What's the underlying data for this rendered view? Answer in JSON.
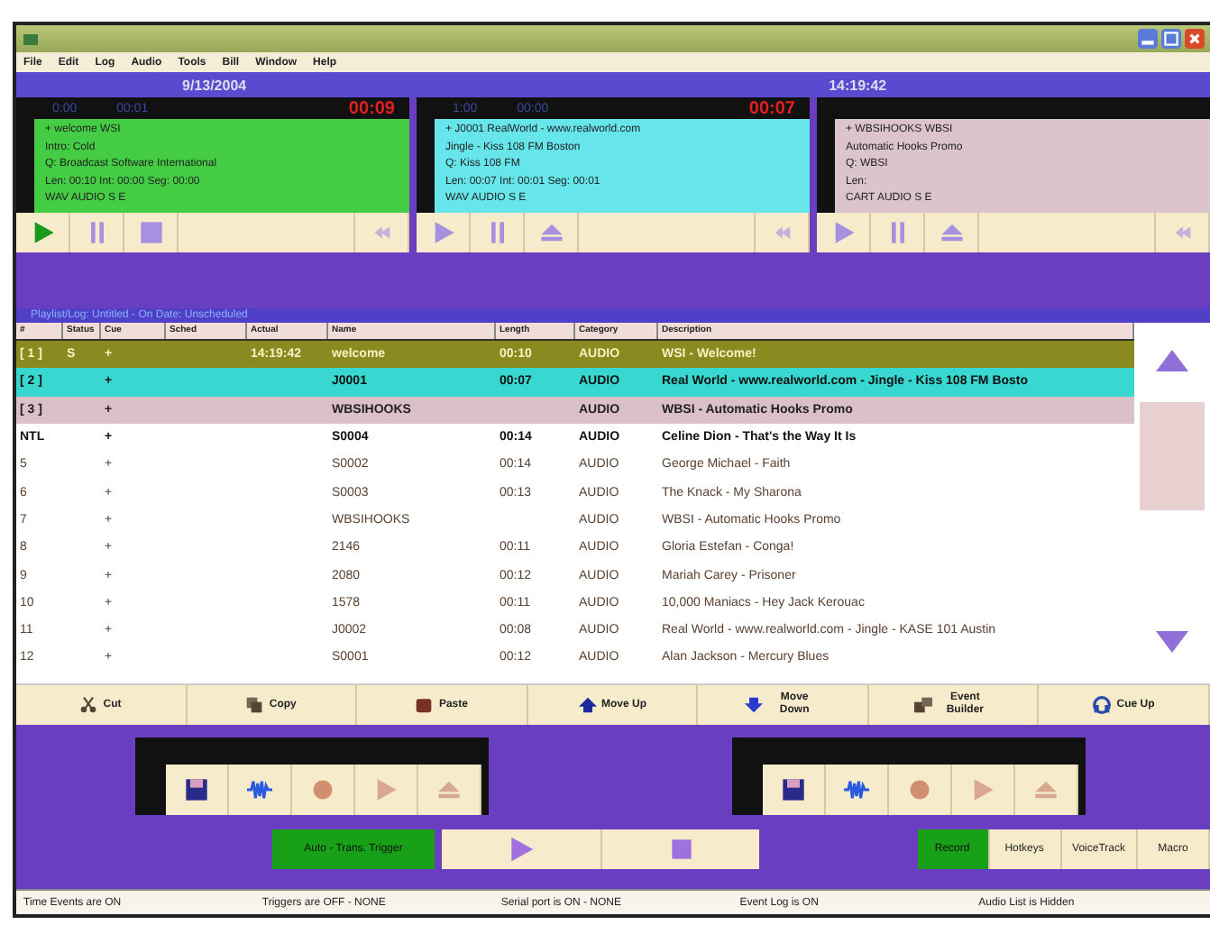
{
  "menu": [
    "File",
    "Edit",
    "Log",
    "Audio",
    "Tools",
    "Bill",
    "Window",
    "Help"
  ],
  "date": "9/13/2004",
  "time": "14:19:42",
  "decks": [
    {
      "color": "#44cc44",
      "playing": true,
      "timers": [
        "0:00",
        "00:01",
        "00:09"
      ],
      "lines": [
        "+ welcome WSI",
        "Intro: Cold",
        "Q: Broadcast Software International",
        "Len: 00:10  Int: 00:00  Seg: 00:00",
        "WAV  AUDIO  S  E"
      ]
    },
    {
      "color": "#66e6ea",
      "playing": false,
      "timers": [
        "1:00",
        "00:00",
        "00:07"
      ],
      "lines": [
        "+ J0001 RealWorld - www.realworld.com",
        "Jingle - Kiss 108 FM Boston",
        "Q: Kiss 108 FM",
        "Len: 00:07  Int: 00:01  Seg: 00:01",
        "WAV  AUDIO  S  E"
      ]
    },
    {
      "color": "#dcc4cc",
      "playing": false,
      "lines": [
        "+ WBSIHOOKS WBSI",
        "Automatic Hooks Promo",
        "Q: WBSI",
        "Len:",
        "CART  AUDIO  S  E"
      ]
    }
  ],
  "playlist": {
    "title": "Playlist/Log: Untitled - On Date: Unscheduled",
    "columns": [
      "#",
      "Status",
      "Cue",
      "Sched",
      "Actual",
      "Name",
      "Length",
      "Category",
      "Description"
    ],
    "rows": [
      {
        "kind": "playing",
        "cells": [
          "[ 1 ]",
          "S",
          "+",
          "",
          "14:19:42",
          "welcome",
          "00:10",
          "AUDIO",
          "WSI - Welcome!"
        ]
      },
      {
        "kind": "next",
        "cells": [
          "[ 2 ]",
          "",
          "+",
          "",
          "",
          "J0001",
          "00:07",
          "AUDIO",
          "Real World - www.realworld.com - Jingle - Kiss 108 FM Bosto"
        ]
      },
      {
        "kind": "cued",
        "cells": [
          "[ 3 ]",
          "",
          "+",
          "",
          "",
          "WBSIHOOKS",
          "",
          "AUDIO",
          "WBSI - Automatic Hooks Promo"
        ]
      },
      {
        "kind": "bold",
        "cells": [
          "NTL",
          "",
          "+",
          "",
          "",
          "S0004",
          "00:14",
          "AUDIO",
          "Celine Dion - That's the Way It Is"
        ]
      },
      {
        "kind": "normal",
        "cells": [
          "5",
          "",
          "+",
          "",
          "",
          "S0002",
          "00:14",
          "AUDIO",
          "George Michael - Faith"
        ]
      },
      {
        "kind": "normal",
        "cells": [
          "6",
          "",
          "+",
          "",
          "",
          "S0003",
          "00:13",
          "AUDIO",
          "The Knack - My Sharona"
        ]
      },
      {
        "kind": "normal",
        "cells": [
          "7",
          "",
          "+",
          "",
          "",
          "WBSIHOOKS",
          "",
          "AUDIO",
          "WBSI - Automatic Hooks Promo"
        ]
      },
      {
        "kind": "normal",
        "cells": [
          "8",
          "",
          "+",
          "",
          "",
          "2146",
          "00:11",
          "AUDIO",
          "Gloria Estefan - Conga!"
        ]
      },
      {
        "kind": "normal",
        "cells": [
          "9",
          "",
          "+",
          "",
          "",
          "2080",
          "00:12",
          "AUDIO",
          "Mariah Carey - Prisoner"
        ]
      },
      {
        "kind": "normal",
        "cells": [
          "10",
          "",
          "+",
          "",
          "",
          "1578",
          "00:11",
          "AUDIO",
          "10,000 Maniacs - Hey Jack Kerouac"
        ]
      },
      {
        "kind": "normal",
        "cells": [
          "11",
          "",
          "+",
          "",
          "",
          "J0002",
          "00:08",
          "AUDIO",
          "Real World - www.realworld.com - Jingle - KASE 101 Austin"
        ]
      },
      {
        "kind": "normal",
        "cells": [
          "12",
          "",
          "+",
          "",
          "",
          "S0001",
          "00:12",
          "AUDIO",
          "Alan Jackson - Mercury Blues"
        ]
      }
    ]
  },
  "toolbar": [
    {
      "kind": "cut",
      "label": "Cut"
    },
    {
      "kind": "copy",
      "label": "Copy"
    },
    {
      "kind": "paste",
      "label": "Paste"
    },
    {
      "kind": "up",
      "label": "Move Up"
    },
    {
      "kind": "down",
      "label": "Move Down"
    },
    {
      "kind": "builder",
      "label": "Event Builder"
    },
    {
      "kind": "cue",
      "label": "Cue Up"
    }
  ],
  "auto_button": "Auto - Trans. Trigger",
  "tabs": [
    {
      "label": "Record",
      "selected": true
    },
    {
      "label": "Hotkeys",
      "selected": false
    },
    {
      "label": "VoiceTrack",
      "selected": false
    },
    {
      "label": "Macro",
      "selected": false
    }
  ],
  "status_bar": [
    "Time Events are ON",
    "Triggers are OFF - NONE",
    "Serial port is ON - NONE",
    "Event Log is ON",
    "Audio List is Hidden"
  ]
}
